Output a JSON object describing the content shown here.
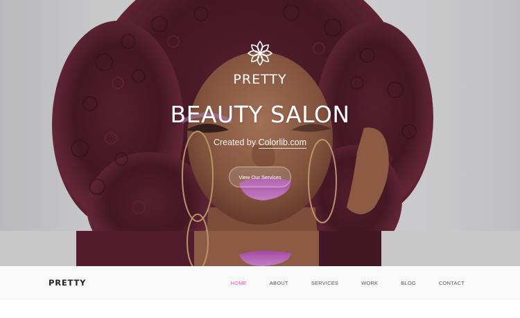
{
  "hero": {
    "brand": "PRETTY",
    "heading": "BEAUTY SALON",
    "subtitle_prefix": "Created by ",
    "subtitle_link": "Colorlib.com",
    "cta_label": "View Our Services",
    "logo_icon": "lotus-flower-icon"
  },
  "navbar": {
    "brand": "PRETTY",
    "links": [
      {
        "label": "HOME",
        "active": true
      },
      {
        "label": "ABOUT",
        "active": false
      },
      {
        "label": "SERVICES",
        "active": false
      },
      {
        "label": "WORK",
        "active": false
      },
      {
        "label": "BLOG",
        "active": false
      },
      {
        "label": "CONTACT",
        "active": false
      }
    ]
  },
  "colors": {
    "accent": "#e455b3",
    "hero_text": "#ffffff",
    "nav_background": "#f9f9f9",
    "nav_text": "#555555"
  }
}
